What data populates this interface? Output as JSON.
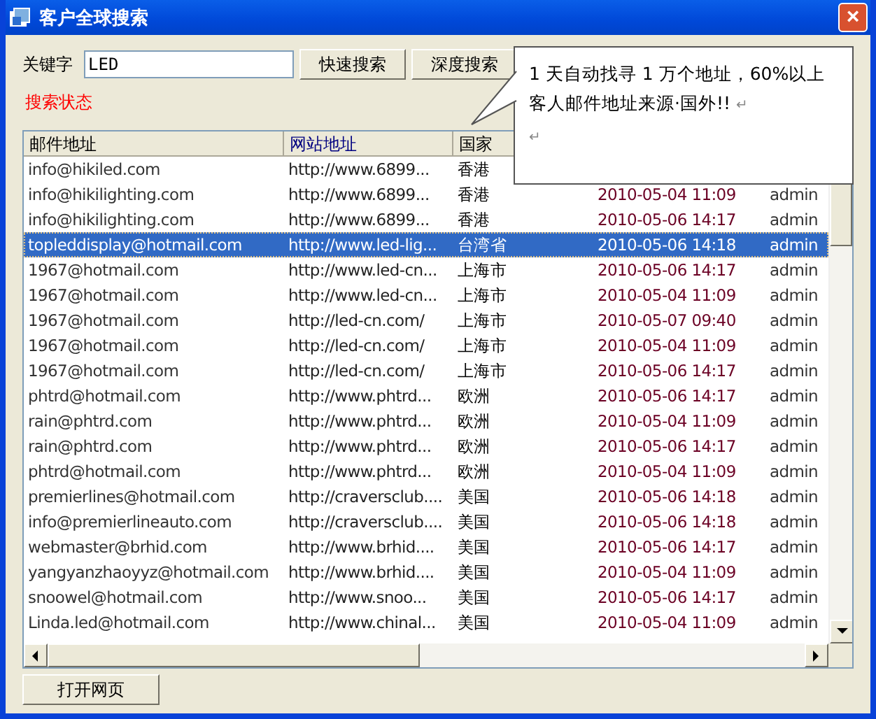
{
  "window": {
    "title": "客户全球搜索",
    "close": "×"
  },
  "search": {
    "label": "关键字",
    "value": "LED",
    "buttons": [
      "快速搜索",
      "深度搜索"
    ]
  },
  "status": "搜索状态",
  "callout": {
    "paragraphs": [
      {
        "text": "1 天自动找寻 1 万个地址，60%以上客人邮件地址来源·国外!!",
        "end_mark": "↵"
      },
      {
        "end_mark": "↵"
      }
    ]
  },
  "table": {
    "columns": [
      {
        "label": "邮件地址",
        "sorted": false
      },
      {
        "label": "网站地址",
        "sorted": true
      },
      {
        "label": "国家",
        "sorted": false
      }
    ],
    "rows": [
      {
        "cells": [
          "info@hikiled.com",
          "http://www.6899...",
          "香港",
          "",
          ""
        ],
        "selected": false
      },
      {
        "cells": [
          "info@hikilighting.com",
          "http://www.6899...",
          "香港",
          "2010-05-04 11:09",
          "admin"
        ],
        "selected": false
      },
      {
        "cells": [
          "info@hikilighting.com",
          "http://www.6899...",
          "香港",
          "2010-05-06 14:17",
          "admin"
        ],
        "selected": false
      },
      {
        "cells": [
          "topleddisplay@hotmail.com",
          "http://www.led-lig...",
          "台湾省",
          "2010-05-06 14:18",
          "admin"
        ],
        "selected": true
      },
      {
        "cells": [
          "1967@hotmail.com",
          "http://www.led-cn...",
          "上海市",
          "2010-05-06 14:17",
          "admin"
        ],
        "selected": false
      },
      {
        "cells": [
          "1967@hotmail.com",
          "http://www.led-cn...",
          "上海市",
          "2010-05-04 11:09",
          "admin"
        ],
        "selected": false
      },
      {
        "cells": [
          "1967@hotmail.com",
          "http://led-cn.com/",
          "上海市",
          "2010-05-07 09:40",
          "admin"
        ],
        "selected": false
      },
      {
        "cells": [
          "1967@hotmail.com",
          "http://led-cn.com/",
          "上海市",
          "2010-05-04 11:09",
          "admin"
        ],
        "selected": false
      },
      {
        "cells": [
          "1967@hotmail.com",
          "http://led-cn.com/",
          "上海市",
          "2010-05-06 14:17",
          "admin"
        ],
        "selected": false
      },
      {
        "cells": [
          "phtrd@hotmail.com",
          "http://www.phtrd...",
          "欧洲",
          "2010-05-06 14:17",
          "admin"
        ],
        "selected": false
      },
      {
        "cells": [
          "rain@phtrd.com",
          "http://www.phtrd...",
          "欧洲",
          "2010-05-04 11:09",
          "admin"
        ],
        "selected": false
      },
      {
        "cells": [
          "rain@phtrd.com",
          "http://www.phtrd...",
          "欧洲",
          "2010-05-06 14:17",
          "admin"
        ],
        "selected": false
      },
      {
        "cells": [
          "phtrd@hotmail.com",
          "http://www.phtrd...",
          "欧洲",
          "2010-05-04 11:09",
          "admin"
        ],
        "selected": false
      },
      {
        "cells": [
          "premierlines@hotmail.com",
          "http://craversclub....",
          "美国",
          "2010-05-06 14:18",
          "admin"
        ],
        "selected": false
      },
      {
        "cells": [
          "info@premierlineauto.com",
          "http://craversclub....",
          "美国",
          "2010-05-06 14:18",
          "admin"
        ],
        "selected": false
      },
      {
        "cells": [
          "webmaster@brhid.com",
          "http://www.brhid....",
          "美国",
          "2010-05-06 14:17",
          "admin"
        ],
        "selected": false
      },
      {
        "cells": [
          "yangyanzhaoyyz@hotmail.com",
          "http://www.brhid....",
          "美国",
          "2010-05-04 11:09",
          "admin"
        ],
        "selected": false
      },
      {
        "cells": [
          "snoowel@hotmail.com",
          "http://www.snoo...",
          "美国",
          "2010-05-06 14:17",
          "admin"
        ],
        "selected": false
      },
      {
        "cells": [
          "Linda.led@hotmail.com",
          "http://www.chinal...",
          "美国",
          "2010-05-04 11:09",
          "admin"
        ],
        "selected": false
      }
    ]
  },
  "open_button": "打开网页"
}
